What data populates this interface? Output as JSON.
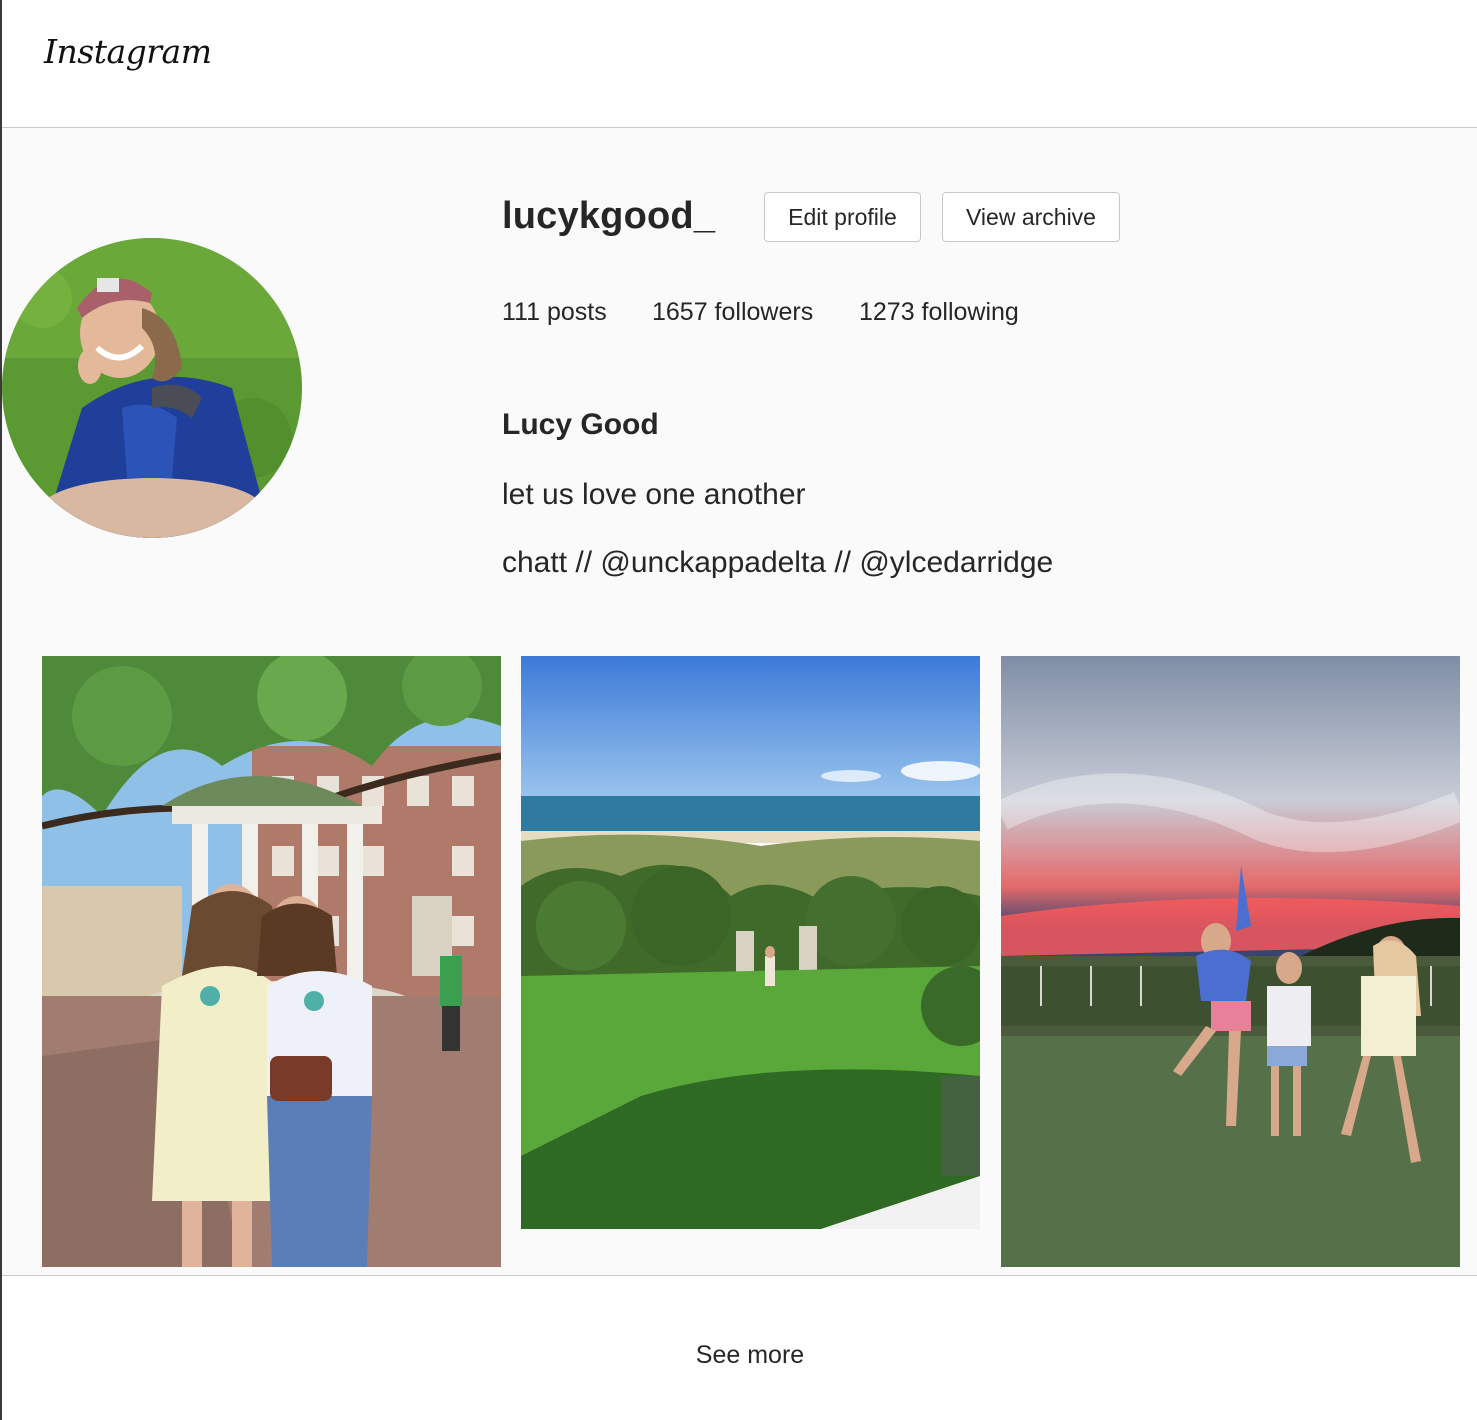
{
  "header": {
    "logo_text": "Instagram"
  },
  "profile": {
    "username": "lucykgood_",
    "edit_profile_label": "Edit profile",
    "view_archive_label": "View archive",
    "stats": {
      "posts": "111 posts",
      "followers": "1657 followers",
      "following": "1273 following"
    },
    "full_name": "Lucy Good",
    "bio_line_1": "let us love one another",
    "bio_line_2": "chatt // @unckappadelta // @ylcedarridge"
  },
  "posts": [
    {
      "scene": "two women in front of a white domed well with brick buildings"
    },
    {
      "scene": "green lawn leading through dunes to the ocean"
    },
    {
      "scene": "three girls jumping in a vineyard at sunset"
    }
  ],
  "footer": {
    "see_more_label": "See more"
  },
  "colors": {
    "text": "#262626",
    "background": "#fafafa",
    "border": "#c9c9c9"
  }
}
